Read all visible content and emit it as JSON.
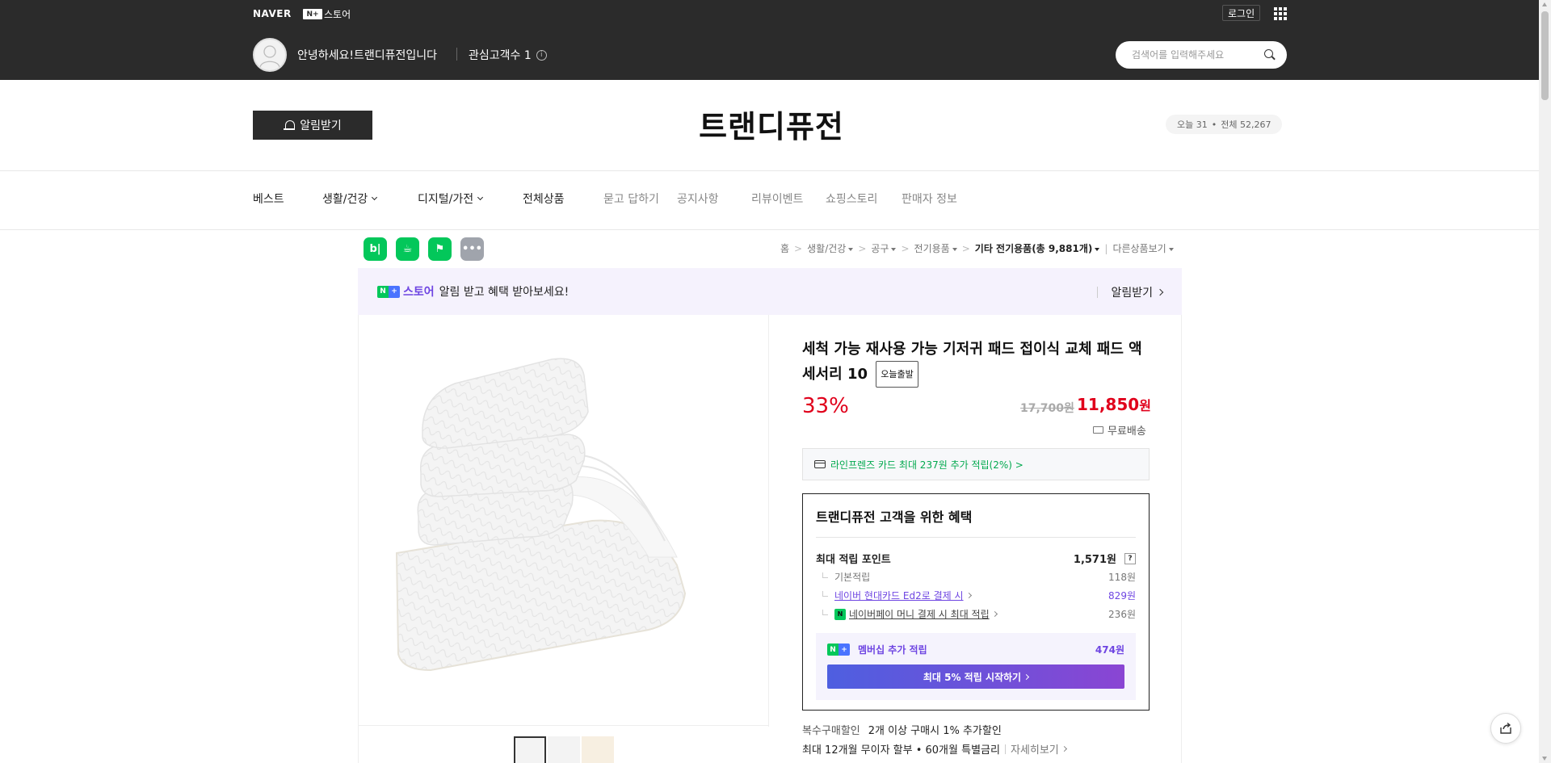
{
  "topbar": {
    "naver_logo": "NAVER",
    "nplus_store": "스토어",
    "nplus_box": "N+",
    "login_label": "로그인",
    "greeting": "안녕하세요!트랜디퓨전입니다",
    "fans_label": "관심고객수 1",
    "info_glyph": "i",
    "search_placeholder": "검색어를 입력해주세요"
  },
  "store": {
    "notify_label": "알림받기",
    "title": "트랜디퓨전",
    "visitors_today": "오늘 31",
    "visitors_dot": "•",
    "visitors_total": "전체 52,267"
  },
  "nav": [
    {
      "label": "베스트",
      "dropdown": false,
      "muted": false
    },
    {
      "label": "생활/건강",
      "dropdown": true,
      "muted": false
    },
    {
      "label": "디지털/가전",
      "dropdown": true,
      "muted": false
    },
    {
      "label": "전체상품",
      "dropdown": false,
      "muted": false
    },
    {
      "label": "묻고 답하기",
      "dropdown": false,
      "muted": true
    },
    {
      "label": "공지사항",
      "dropdown": false,
      "muted": true
    },
    {
      "label": "리뷰이벤트",
      "dropdown": false,
      "muted": true
    },
    {
      "label": "쇼핑스토리",
      "dropdown": false,
      "muted": true
    },
    {
      "label": "판매자 정보",
      "dropdown": false,
      "muted": true
    }
  ],
  "action_icons": [
    {
      "name": "blog-icon",
      "glyph": "b|",
      "color": "#03c75a"
    },
    {
      "name": "cafe-icon",
      "glyph": "☕",
      "color": "#03c75a"
    },
    {
      "name": "bookmark-icon",
      "glyph": "⚑",
      "color": "#03c75a"
    },
    {
      "name": "more-icon",
      "glyph": "•••",
      "color": "#a0a4ac"
    }
  ],
  "breadcrumb": {
    "home": "홈",
    "sep": ">",
    "c1": "생활/건강",
    "c2": "공구",
    "c3": "전기용품",
    "c4": "기타 전기용품(총 9,881개)",
    "other": "다른상품보기"
  },
  "banner": {
    "store_label": "스토어",
    "text": "알림 받고 혜택 받아보세요!",
    "right_label": "알림받기",
    "badge_n": "N",
    "badge_plus": "+"
  },
  "product": {
    "title": "세척 가능 재사용 가능 기저귀 패드 접이식 교체 패드 액세서리 10",
    "today_badge": "오늘출발",
    "discount": "33%",
    "original_price": "17,700원",
    "sale_price_num": "11,850",
    "sale_price_unit": "원",
    "shipping": "무료배송"
  },
  "card_offer": "라인프렌즈 카드 최대 237원 추가 적립(2%) >",
  "benefit": {
    "heading": "트랜디퓨전 고객을 위한 혜택",
    "max_points_label": "최대 적립 포인트",
    "max_points_value": "1,571원",
    "question_glyph": "?",
    "rows": [
      {
        "label": "기본적립",
        "value": "118원"
      },
      {
        "label": "네이버 현대카드 Ed2로 결제 시",
        "value": "829원"
      },
      {
        "label": "네이버페이 머니 결제 시 최대 적립",
        "value": "236원"
      }
    ],
    "npay_glyph": "N",
    "membership_label": "멤버십 추가 적립",
    "membership_value": "474원",
    "membership_cta": "최대 5% 적립 시작하기"
  },
  "bulk": {
    "label": "복수구매할인",
    "text": "2개 이상 구매시 1% 추가할인"
  },
  "installment": {
    "text": "최대 12개월 무이자 할부 • 60개월 특별금리",
    "more": "자세히보기"
  },
  "colors": {
    "topbar": "#2b2b2b",
    "accent_red": "#e0001b",
    "naver_green": "#03c75a",
    "purple": "#6e45e2"
  }
}
